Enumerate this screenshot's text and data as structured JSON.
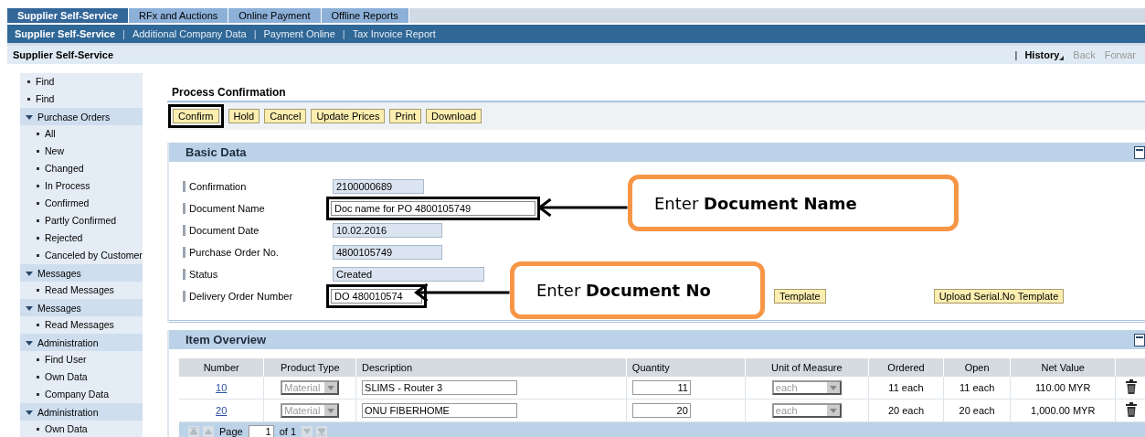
{
  "top_tabs": [
    {
      "label": "Supplier Self-Service",
      "selected": true
    },
    {
      "label": "RFx and Auctions",
      "selected": false
    },
    {
      "label": "Online Payment",
      "selected": false
    },
    {
      "label": "Offline Reports",
      "selected": false
    }
  ],
  "sub_nav": {
    "separator": "|",
    "items": [
      {
        "label": "Supplier Self-Service",
        "selected": true
      },
      {
        "label": "Additional Company Data",
        "selected": false
      },
      {
        "label": "Payment Online",
        "selected": false
      },
      {
        "label": "Tax Invoice Report",
        "selected": false
      }
    ]
  },
  "breadcrumb": {
    "title": "Supplier Self-Service",
    "separator": "|",
    "links": [
      {
        "label": "History",
        "disabled": false
      },
      {
        "label": "Back",
        "disabled": true
      },
      {
        "label": "Forwar",
        "disabled": true
      }
    ]
  },
  "sidebar": {
    "items": [
      {
        "kind": "link",
        "label": "Find"
      },
      {
        "kind": "link",
        "label": "Find"
      },
      {
        "kind": "group",
        "label": "Purchase Orders",
        "expanded": true,
        "children": [
          {
            "label": "All"
          },
          {
            "label": "New"
          },
          {
            "label": "Changed"
          },
          {
            "label": "In Process"
          },
          {
            "label": "Confirmed"
          },
          {
            "label": "Partly Confirmed"
          },
          {
            "label": "Rejected"
          },
          {
            "label": "Canceled by Customer"
          }
        ]
      },
      {
        "kind": "group",
        "label": "Messages",
        "expanded": true,
        "children": [
          {
            "label": "Read Messages"
          }
        ]
      },
      {
        "kind": "group",
        "label": "Messages",
        "expanded": true,
        "children": [
          {
            "label": "Read Messages"
          }
        ]
      },
      {
        "kind": "group",
        "label": "Administration",
        "expanded": true,
        "children": [
          {
            "label": "Find User"
          },
          {
            "label": "Own Data"
          },
          {
            "label": "Company Data"
          }
        ]
      },
      {
        "kind": "group",
        "label": "Administration",
        "expanded": true,
        "children": [
          {
            "label": "Own Data"
          }
        ]
      }
    ]
  },
  "title": "Process Confirmation",
  "actions": [
    {
      "label": "Confirm",
      "highlighted": true
    },
    {
      "label": "Hold",
      "highlighted": false
    },
    {
      "label": "Cancel",
      "highlighted": false
    },
    {
      "label": "Update Prices",
      "highlighted": false
    },
    {
      "label": "Print",
      "highlighted": false
    },
    {
      "label": "Download",
      "highlighted": false
    }
  ],
  "basic_data": {
    "title": "Basic Data",
    "fields": [
      {
        "label": "Confirmation",
        "value": "2100000689",
        "editable": false,
        "highlighted": false
      },
      {
        "label": "Document Name",
        "value": "Doc name for PO 4800105749",
        "editable": true,
        "highlighted": true
      },
      {
        "label": "Document Date",
        "value": "10.02.2016",
        "editable": false,
        "highlighted": false
      },
      {
        "label": "Purchase Order No.",
        "value": "4800105749",
        "editable": false,
        "highlighted": false
      },
      {
        "label": "Status",
        "value": "Created",
        "editable": false,
        "highlighted": false
      },
      {
        "label": "Delivery Order Number",
        "value": "DO 480010574",
        "editable": true,
        "highlighted": true
      }
    ],
    "template_buttons": [
      "Template",
      "Upload Serial.No Template"
    ]
  },
  "item_overview": {
    "title": "Item Overview",
    "columns": [
      "Number",
      "Product Type",
      "Description",
      "Quantity",
      "Unit of Measure",
      "Ordered",
      "Open",
      "Net Value"
    ],
    "rows": [
      {
        "number": "10",
        "product_type": "Material",
        "description": "SLIMS - Router 3",
        "quantity": "11",
        "unit": "each",
        "ordered": "11 each",
        "open": "11 each",
        "net_value": "110.00 MYR"
      },
      {
        "number": "20",
        "product_type": "Material",
        "description": "ONU FIBERHOME",
        "quantity": "20",
        "unit": "each",
        "ordered": "20 each",
        "open": "20 each",
        "net_value": "1,000.00 MYR"
      }
    ],
    "pager": {
      "label": "Page",
      "value": "1",
      "total": "of 1"
    }
  },
  "callouts": [
    {
      "text": "Enter **Document Name**"
    },
    {
      "text": "Enter **Document No**"
    }
  ]
}
